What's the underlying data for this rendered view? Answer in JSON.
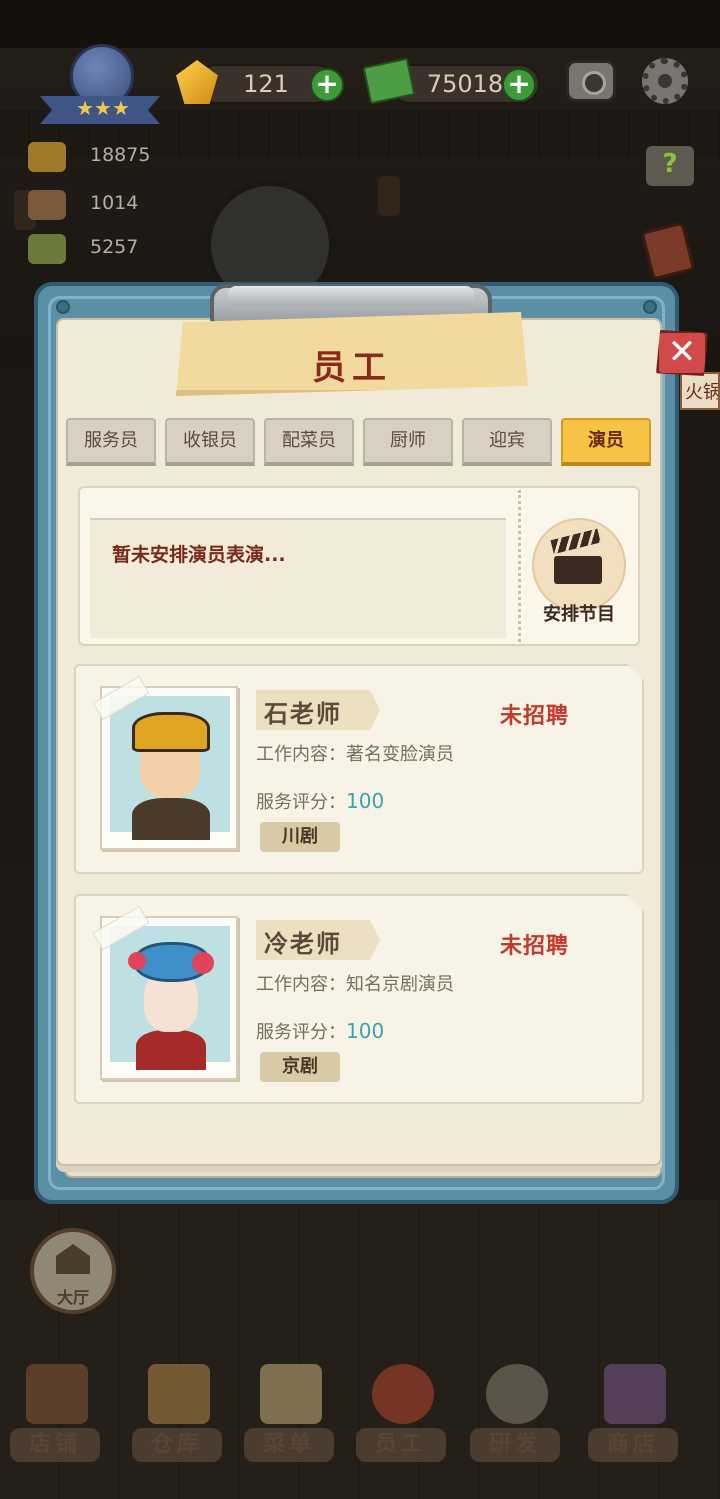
{
  "hud": {
    "gems": "121",
    "cash": "75018",
    "stats": [
      "18875",
      "1014",
      "5257"
    ]
  },
  "side_sign": "火锅",
  "dialog": {
    "title": "员工",
    "close_label": "✕",
    "tabs": [
      {
        "label": "服务员",
        "active": false
      },
      {
        "label": "收银员",
        "active": false
      },
      {
        "label": "配菜员",
        "active": false
      },
      {
        "label": "厨师",
        "active": false
      },
      {
        "label": "迎宾",
        "active": false
      },
      {
        "label": "演员",
        "active": true
      }
    ],
    "arrangement": {
      "message": "暂未安排演员表演...",
      "button_label": "安排节目"
    },
    "staff": [
      {
        "name": "石老师",
        "status": "未招聘",
        "work": "工作内容：著名变脸演员",
        "score_label": "服务评分：",
        "score": "100",
        "genre": "川剧"
      },
      {
        "name": "冷老师",
        "status": "未招聘",
        "work": "工作内容：知名京剧演员",
        "score_label": "服务评分：",
        "score": "100",
        "genre": "京剧"
      }
    ]
  },
  "hall_button": "大厅",
  "nav": [
    "店铺",
    "仓库",
    "菜单",
    "员工",
    "研发",
    "商店"
  ]
}
